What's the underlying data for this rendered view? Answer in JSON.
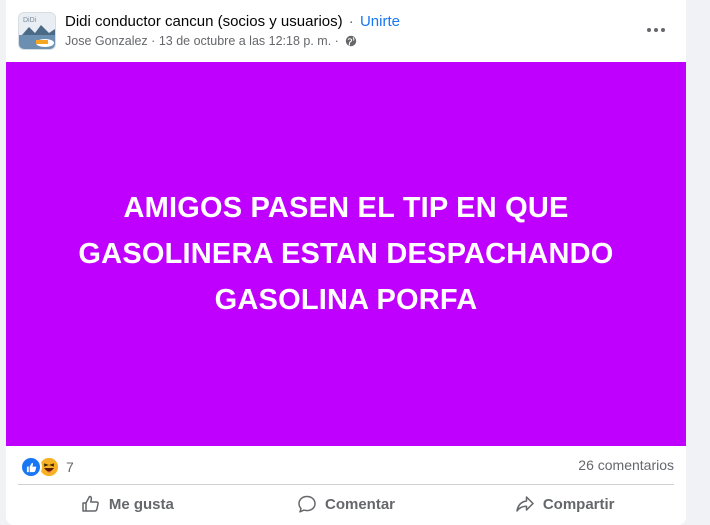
{
  "header": {
    "group_name": "Didi conductor cancun (socios y usuarios)",
    "separator": "·",
    "join_label": "Unirte",
    "author": "Jose Gonzalez",
    "meta_separator": "·",
    "timestamp": "13 de octubre a las 12:18 p. m.",
    "meta_separator_2": "·",
    "privacy_icon": "globe-icon",
    "more_icon": "more-options-icon"
  },
  "post": {
    "background_color": "#c000ff",
    "text_line_1": "AMIGOS PASEN EL TIP EN QUE",
    "text_line_2": "GASOLINERA ESTAN DESPACHANDO",
    "text_line_3": "GASOLINA PORFA"
  },
  "stats": {
    "reaction_icons": [
      "like-reaction-icon",
      "haha-reaction-icon"
    ],
    "reaction_count": "7",
    "comments_label": "26 comentarios"
  },
  "actions": {
    "like_label": "Me gusta",
    "comment_label": "Comentar",
    "share_label": "Compartir"
  },
  "colors": {
    "accent": "#1877f2",
    "secondary_text": "#65676b"
  }
}
